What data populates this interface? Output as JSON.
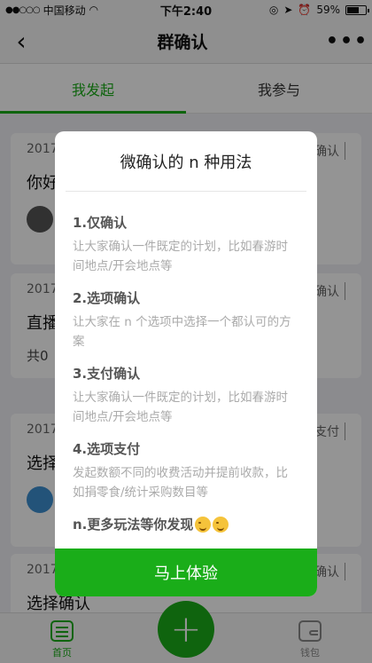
{
  "status_bar": {
    "carrier": "中国移动",
    "time": "下午2:40",
    "battery": "59%"
  },
  "nav": {
    "title": "群确认",
    "back_icon": "chevron-left-icon",
    "more_icon": "more-dots-icon"
  },
  "tabs": [
    {
      "label": "我发起",
      "active": true
    },
    {
      "label": "我参与",
      "active": false
    }
  ],
  "cards": [
    {
      "date": "2017",
      "tag": "确认",
      "title": "你好"
    },
    {
      "date": "2017",
      "tag": "确认",
      "title": "直播",
      "sub": "共0"
    },
    {
      "date": "2017",
      "tag": "支付",
      "title": "选择"
    },
    {
      "date": "2017",
      "tag": "确认",
      "title": "选择确认"
    }
  ],
  "tabbar": {
    "home_label": "首页",
    "wallet_label": "钱包"
  },
  "dialog": {
    "title": "微确认的 n 种用法",
    "sections": [
      {
        "heading": "1.仅确认",
        "desc": "让大家确认一件既定的计划，比如春游时间地点/开会地点等"
      },
      {
        "heading": "2.选项确认",
        "desc": "让大家在 n 个选项中选择一个都认可的方案"
      },
      {
        "heading": "3.支付确认",
        "desc": "让大家确认一件既定的计划，比如春游时间地点/开会地点等"
      },
      {
        "heading": "4.选项支付",
        "desc": "发起数额不同的收费活动并提前收款，比如捐零食/统计采购数目等"
      }
    ],
    "more_text": "n.更多玩法等你发现",
    "cta_label": "马上体验"
  },
  "colors": {
    "accent": "#1aad19"
  }
}
